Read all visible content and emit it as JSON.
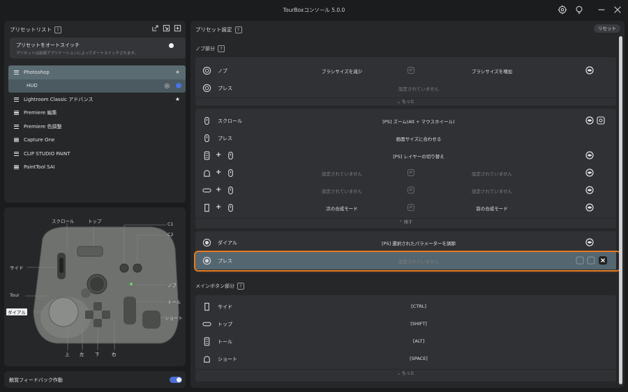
{
  "app": {
    "title": "TourBoxコンソール 5.0.0",
    "icons": [
      "gear-icon",
      "lightbulb-icon",
      "minimize-icon",
      "close-icon"
    ]
  },
  "preset_panel": {
    "title": "プリセットリスト",
    "help": "?",
    "auto_switch": {
      "label": "プリセットをオートスイッチ",
      "description": "プリセットは前面アプリケーションによってオートスイッチされます。",
      "enabled": false
    },
    "presets": [
      {
        "label": "Photoshop",
        "starred": true,
        "active": true
      },
      {
        "label": "HUD",
        "sub": true
      },
      {
        "label": "Lightroom Classic アドバンス",
        "starred": true
      },
      {
        "label": "Premiere 編集"
      },
      {
        "label": "Premiere 色調整"
      },
      {
        "label": "Capture One"
      },
      {
        "label": "CLIP STUDIO PAINT"
      },
      {
        "label": "PaintTool SAI"
      }
    ]
  },
  "device": {
    "labels": {
      "scroll": "スクロール",
      "top": "トップ",
      "c1": "C1",
      "c2": "C2",
      "side": "サイド",
      "knob": "ノブ",
      "tour": "Tour",
      "tall": "トール",
      "dial": "ダイアル",
      "short": "ショート",
      "up": "上",
      "left": "左",
      "down": "下",
      "right": "右"
    },
    "highlighted": "dial"
  },
  "haptic": {
    "label": "触覚フィードバック作動",
    "enabled": true
  },
  "settings": {
    "title": "プリセット設定",
    "reset": "リセット",
    "knob_section": "ノブ部分",
    "main_section": "メインボタン部分",
    "knob_card": {
      "rows": [
        {
          "name": "ノブ",
          "a1": "ブラシサイズを減少",
          "a2": "ブラシサイズを増加"
        },
        {
          "name": "プレス",
          "mid": "設定されていません"
        }
      ],
      "more": "もっと"
    },
    "scroll_card": {
      "rows": [
        {
          "name": "スクロール",
          "mid": "[PS] ズーム(Alt + マウスホイール)"
        },
        {
          "name": "プレス",
          "mid": "画面サイズに合わせる"
        },
        {
          "combo": true,
          "mid": "[PS] レイヤーの切り替え"
        },
        {
          "combo": true,
          "a1": "設定されていません",
          "a2": "設定されていません"
        },
        {
          "combo": true,
          "a1": "設定されていません",
          "a2": "設定されていません"
        },
        {
          "combo": true,
          "a1": "次の合成モード",
          "a2": "前の合成モード"
        }
      ],
      "collapse": "隠す"
    },
    "dial_card": {
      "rows": [
        {
          "name": "ダイアル",
          "mid": "[PS] 選択されたパラメーターを調節"
        },
        {
          "name": "プレス",
          "mid": "設定されていません"
        }
      ]
    },
    "main_card": {
      "rows": [
        {
          "name": "サイド",
          "mid": "[CTRL]"
        },
        {
          "name": "トップ",
          "mid": "[SHIFT]"
        },
        {
          "name": "トール",
          "mid": "[ALT]"
        },
        {
          "name": "ショート",
          "mid": "[SPACE]"
        }
      ],
      "more": "もっと"
    }
  },
  "colors": {
    "accent": "#4a72e0",
    "highlight": "#e67a1e",
    "active_row": "#5a6c72"
  }
}
